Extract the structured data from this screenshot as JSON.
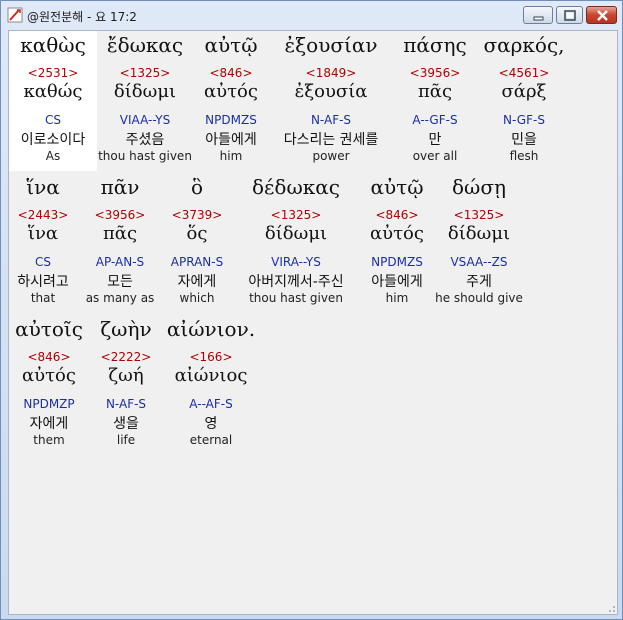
{
  "window": {
    "title": "@원전분해 - 요 17:2",
    "controls": {
      "minimize": "minimize",
      "maximize": "maximize",
      "close": "close"
    }
  },
  "rows": [
    [
      {
        "greek": "καθὼς",
        "strong": "<2531>",
        "lemma": "καθώς",
        "parse": "CS",
        "korean": "이로소이다",
        "english": "As"
      },
      {
        "greek": "ἔδωκας",
        "strong": "<1325>",
        "lemma": "δίδωμι",
        "parse": "VIAA--YS",
        "korean": "주셨음",
        "english": "thou hast given"
      },
      {
        "greek": "αὐτῷ",
        "strong": "<846>",
        "lemma": "αὐτός",
        "parse": "NPDMZS",
        "korean": "아들에게",
        "english": "him"
      },
      {
        "greek": "ἐξουσίαν",
        "strong": "<1849>",
        "lemma": "ἐξουσία",
        "parse": "N-AF-S",
        "korean": "다스리는 권세를",
        "english": "power"
      },
      {
        "greek": "πάσης",
        "strong": "<3956>",
        "lemma": "πᾶς",
        "parse": "A--GF-S",
        "korean": "만",
        "english": "over all"
      },
      {
        "greek": "σαρκός,",
        "strong": "<4561>",
        "lemma": "σάρξ",
        "parse": "N-GF-S",
        "korean": "민을",
        "english": "flesh"
      }
    ],
    [
      {
        "greek": "ἵνα",
        "strong": "<2443>",
        "lemma": "ἵνα",
        "parse": "CS",
        "korean": "하시려고",
        "english": "that"
      },
      {
        "greek": "πᾶν",
        "strong": "<3956>",
        "lemma": "πᾶς",
        "parse": "AP-AN-S",
        "korean": "모든",
        "english": "as many as"
      },
      {
        "greek": "ὃ",
        "strong": "<3739>",
        "lemma": "ὅς",
        "parse": "APRAN-S",
        "korean": "자에게",
        "english": "which"
      },
      {
        "greek": "δέδωκας",
        "strong": "<1325>",
        "lemma": "δίδωμι",
        "parse": "VIRA--YS",
        "korean": "아버지께서-주신",
        "english": "thou hast given"
      },
      {
        "greek": "αὐτῷ",
        "strong": "<846>",
        "lemma": "αὐτός",
        "parse": "NPDMZS",
        "korean": "아들에게",
        "english": "him"
      },
      {
        "greek": "δώσῃ",
        "strong": "<1325>",
        "lemma": "δίδωμι",
        "parse": "VSAA--ZS",
        "korean": "주게",
        "english": "he should give"
      }
    ],
    [
      {
        "greek": "αὐτοῖς",
        "strong": "<846>",
        "lemma": "αὐτός",
        "parse": "NPDMZP",
        "korean": "자에게",
        "english": "them"
      },
      {
        "greek": "ζωὴν",
        "strong": "<2222>",
        "lemma": "ζωή",
        "parse": "N-AF-S",
        "korean": "생을",
        "english": "life"
      },
      {
        "greek": "αἰώνιον.",
        "strong": "<166>",
        "lemma": "αἰώνιος",
        "parse": "A--AF-S",
        "korean": "영",
        "english": "eternal"
      }
    ]
  ],
  "colors": {
    "strong": "#b00000",
    "parse": "#1a2ea8"
  }
}
